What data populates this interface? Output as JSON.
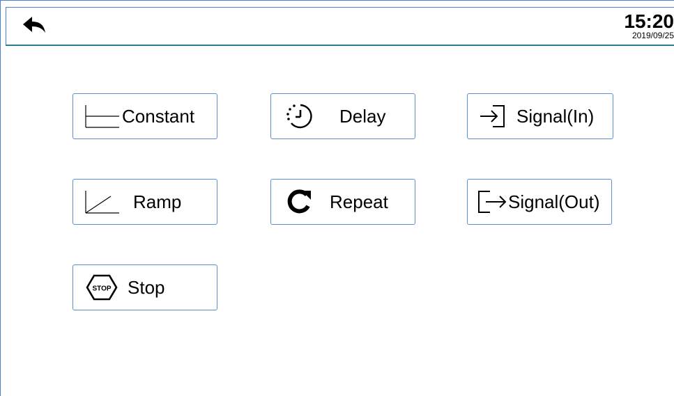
{
  "header": {
    "back_icon": "back-arrow-icon",
    "time": "15:20",
    "date": "2019/09/25"
  },
  "buttons": {
    "constant": {
      "label": "Constant",
      "icon": "constant-line-icon"
    },
    "delay": {
      "label": "Delay",
      "icon": "timer-icon"
    },
    "signal_in": {
      "label": "Signal(In)",
      "icon": "signal-in-icon"
    },
    "ramp": {
      "label": "Ramp",
      "icon": "ramp-line-icon"
    },
    "repeat": {
      "label": "Repeat",
      "icon": "repeat-icon"
    },
    "signal_out": {
      "label": "Signal(Out)",
      "icon": "signal-out-icon"
    },
    "stop": {
      "label": "Stop",
      "icon": "stop-sign-icon",
      "icon_text": "STOP"
    }
  },
  "colors": {
    "border_accent": "#4a7fd4",
    "header_divider": "#2e7d8c"
  }
}
